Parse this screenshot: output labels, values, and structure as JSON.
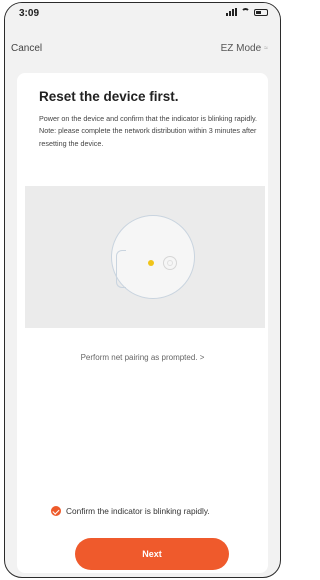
{
  "status_bar": {
    "time": "3:09",
    "icons": [
      "signal-icon",
      "wifi-icon",
      "battery-icon"
    ]
  },
  "nav": {
    "cancel_label": "Cancel",
    "mode_label": "EZ Mode"
  },
  "content": {
    "title": "Reset the device first.",
    "description": "Power on the device and confirm that the indicator is blinking rapidly.\nNote: please complete the network distribution within 3 minutes after resetting the device.",
    "pairing_link": "Perform net pairing as prompted. >",
    "confirm_label": "Confirm the indicator is blinking rapidly.",
    "next_label": "Next"
  },
  "colors": {
    "accent": "#ef5a2c",
    "indicator": "#f0c419",
    "background": "#f2f2f2"
  }
}
